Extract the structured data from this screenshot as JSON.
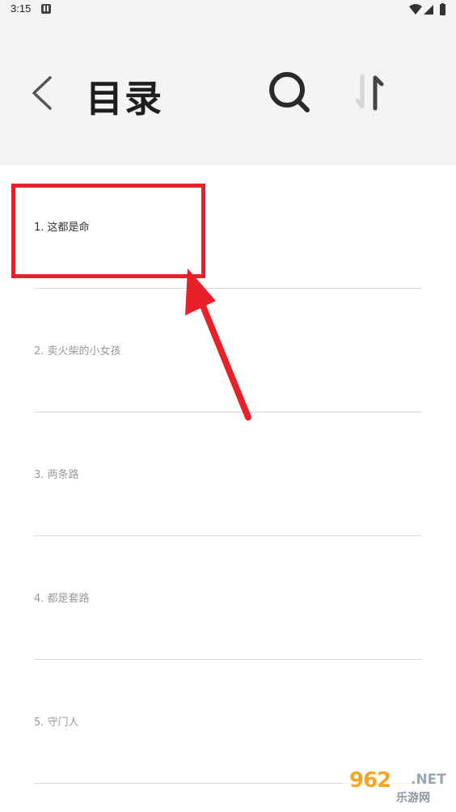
{
  "status_bar": {
    "time": "3:15"
  },
  "header": {
    "title": "目录"
  },
  "chapters": [
    {
      "label": "1. 这都是命",
      "current": true
    },
    {
      "label": "2. 卖火柴的小女孩",
      "current": false
    },
    {
      "label": "3. 两条路",
      "current": false
    },
    {
      "label": "4. 都是套路",
      "current": false
    },
    {
      "label": "5. 守门人",
      "current": false
    }
  ],
  "watermark": {
    "brand": "962",
    "suffix": ".NET",
    "site_name": "乐游网"
  },
  "colors": {
    "highlight": "#e8202a",
    "header_bg": "#f3f4f6",
    "divider": "#d9d9d9"
  }
}
